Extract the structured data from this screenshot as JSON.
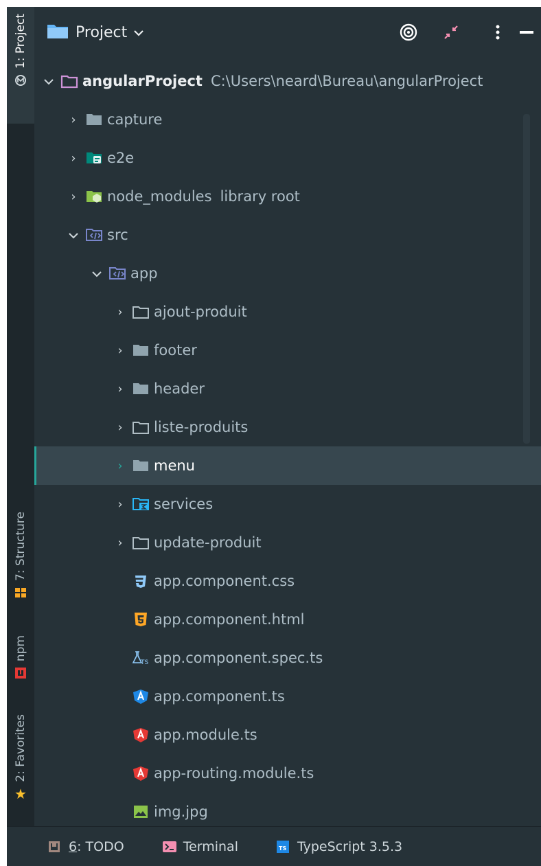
{
  "header": {
    "title": "Project",
    "icons": [
      "project-folder-icon",
      "chevron-down-icon",
      "target-icon",
      "collapse-icon",
      "more-vert-icon",
      "minimize-icon"
    ]
  },
  "left_strip": {
    "tabs": [
      {
        "label": "1: Project",
        "icon": "settings-icon"
      },
      {
        "label": "7: Structure",
        "icon": "structure-icon"
      },
      {
        "label": "npm",
        "icon": "npm-icon"
      },
      {
        "label": "2: Favorites",
        "icon": "star-icon"
      }
    ]
  },
  "tree": {
    "root": {
      "name": "angularProject",
      "path": "C:\\Users\\neard\\Bureau\\angularProject"
    },
    "items": [
      {
        "name": "capture",
        "icon": "folder-icon",
        "arrow": "›"
      },
      {
        "name": "e2e",
        "icon": "test-folder-icon",
        "arrow": "›"
      },
      {
        "name": "node_modules",
        "suffix": "library root",
        "icon": "library-folder-icon",
        "arrow": "›"
      },
      {
        "name": "src",
        "icon": "source-folder-icon",
        "arrow": "⌄"
      },
      {
        "name": "app",
        "icon": "source-folder-icon",
        "arrow": "⌄"
      },
      {
        "name": "ajout-produit",
        "icon": "folder-outline-icon",
        "arrow": "›"
      },
      {
        "name": "footer",
        "icon": "folder-icon",
        "arrow": "›"
      },
      {
        "name": "header",
        "icon": "folder-icon",
        "arrow": "›"
      },
      {
        "name": "liste-produits",
        "icon": "folder-outline-icon",
        "arrow": "›"
      },
      {
        "name": "menu",
        "icon": "folder-icon",
        "arrow": "›"
      },
      {
        "name": "services",
        "icon": "services-folder-icon",
        "arrow": "›"
      },
      {
        "name": "update-produit",
        "icon": "folder-outline-icon",
        "arrow": "›"
      },
      {
        "name": "app.component.css",
        "icon": "css-icon"
      },
      {
        "name": "app.component.html",
        "icon": "html-icon"
      },
      {
        "name": "app.component.spec.ts",
        "icon": "test-ts-icon"
      },
      {
        "name": "app.component.ts",
        "icon": "angular-component-icon"
      },
      {
        "name": "app.module.ts",
        "icon": "angular-icon"
      },
      {
        "name": "app-routing.module.ts",
        "icon": "angular-icon"
      },
      {
        "name": "img.jpg",
        "icon": "image-icon"
      }
    ],
    "selected": "menu"
  },
  "bottom_bar": {
    "todo": {
      "mnemonic": "6",
      "rest": ": TODO"
    },
    "terminal": "Terminal",
    "typescript": "TypeScript 3.5.3"
  },
  "colors": {
    "background": "#263238",
    "selection": "#37474f",
    "accent": "#26a69a"
  }
}
